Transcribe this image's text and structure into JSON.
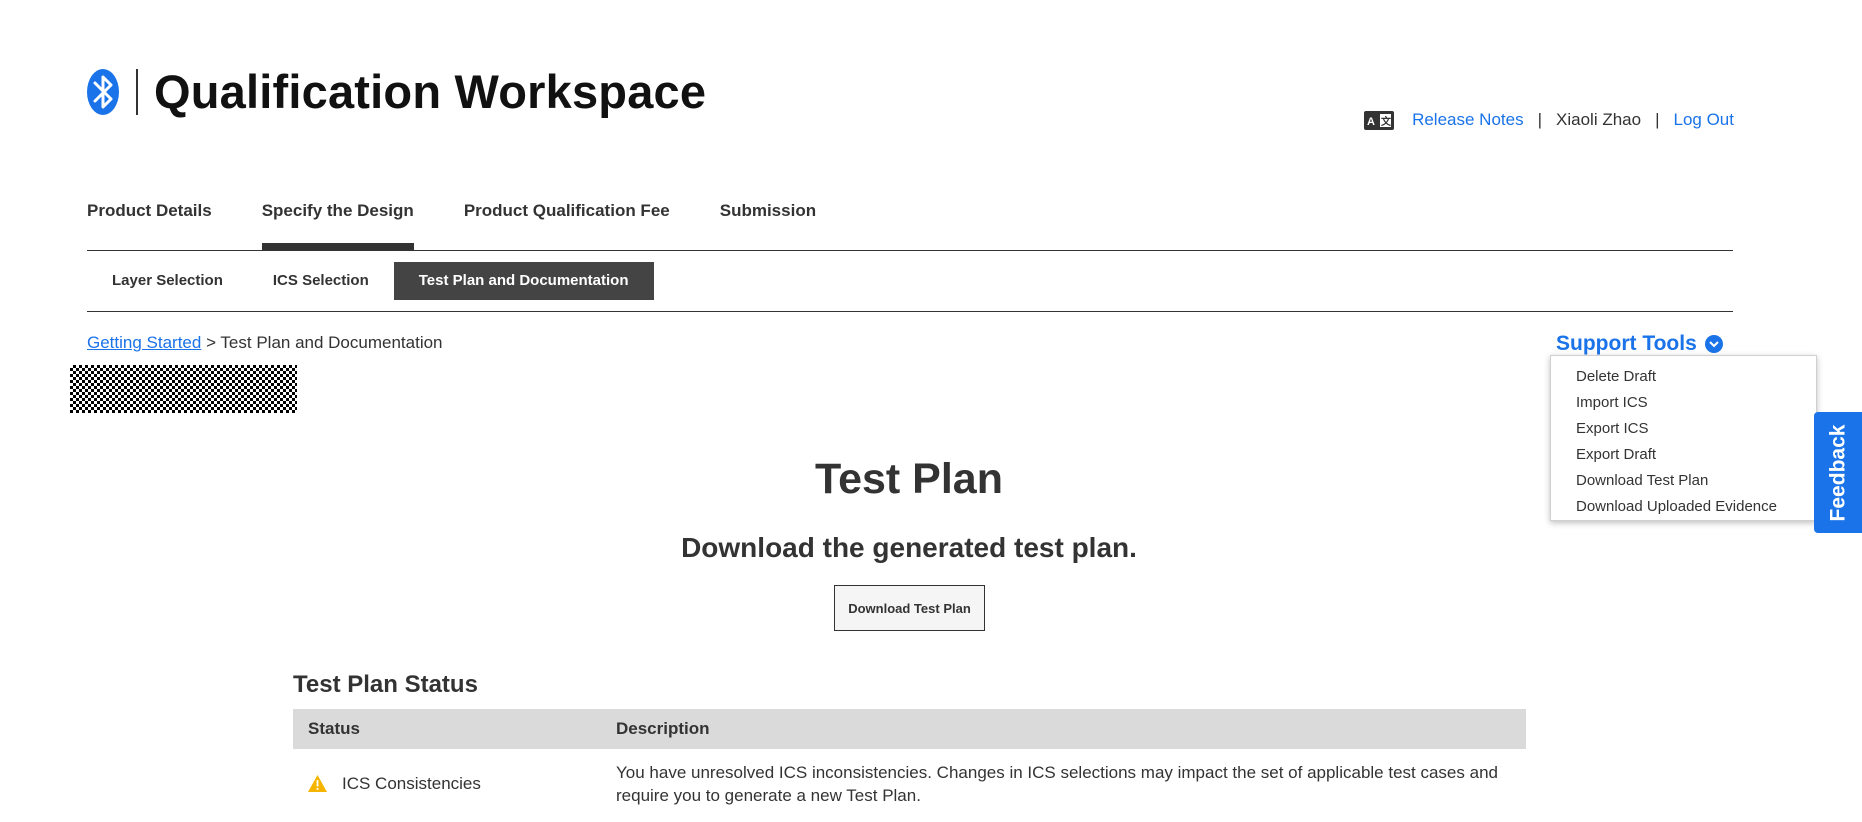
{
  "header": {
    "app_title": "Qualification Workspace",
    "logo_icon": "bluetooth-icon",
    "translate_icon": "translate-icon",
    "release_notes": "Release Notes",
    "separator": "|",
    "user_name": "Xiaoli Zhao",
    "logout": "Log Out"
  },
  "main_tabs": [
    {
      "label": "Product Details",
      "active": false
    },
    {
      "label": "Specify the Design",
      "active": true
    },
    {
      "label": "Product Qualification Fee",
      "active": false
    },
    {
      "label": "Submission",
      "active": false
    }
  ],
  "sub_tabs": [
    {
      "label": "Layer Selection",
      "active": false
    },
    {
      "label": "ICS Selection",
      "active": false
    },
    {
      "label": "Test Plan and Documentation",
      "active": true
    }
  ],
  "breadcrumb": {
    "link": "Getting Started",
    "current": "> Test Plan and Documentation"
  },
  "support_tools": {
    "label": "Support Tools",
    "icon": "chevron-down-icon",
    "items": [
      "Delete Draft",
      "Import ICS",
      "Export ICS",
      "Export Draft",
      "Download Test Plan",
      "Download Uploaded Evidence"
    ]
  },
  "feedback": "Feedback",
  "content": {
    "title": "Test Plan",
    "subtitle": "Download the generated test plan.",
    "download_button": "Download Test Plan",
    "status_heading": "Test Plan Status",
    "table_headers": [
      "Status",
      "Description"
    ],
    "rows": [
      {
        "icon": "warning-icon",
        "status": "ICS Consistencies",
        "description": "You have unresolved ICS inconsistencies. Changes in ICS selections may impact the set of applicable test cases and require you to generate a new Test Plan."
      }
    ]
  },
  "colors": {
    "accent": "#1a73e8",
    "active_tab_bg": "#444444",
    "warning": "#f5b400"
  }
}
